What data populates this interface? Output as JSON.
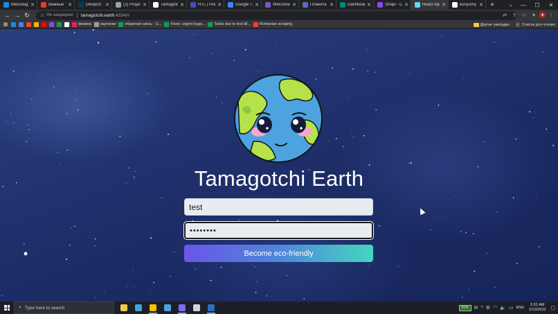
{
  "browser": {
    "tabs": [
      {
        "label": "Мессенд",
        "color": "#1e88e5"
      },
      {
        "label": "Важные те",
        "color": "#e53935"
      },
      {
        "label": "Devpost",
        "color": "#003e54",
        "glyph": "D"
      },
      {
        "label": "(2) Project",
        "color": "#90a4ae"
      },
      {
        "label": "Tamagotc",
        "color": "#ffffff"
      },
      {
        "label": "HTL | Prezi",
        "color": "#3f51b5"
      },
      {
        "label": "Google Tra",
        "color": "#4285f4"
      },
      {
        "label": "Welcome t",
        "color": "#7e57c2"
      },
      {
        "label": "Планета —",
        "color": "#5c6bc0"
      },
      {
        "label": "Dashboard",
        "color": "#00897b"
      },
      {
        "label": "Strapi - Co",
        "color": "#8e44ff"
      },
      {
        "label": "React App",
        "color": "#61dafb",
        "active": true
      },
      {
        "label": "kuriyumy",
        "color": "#ffffff"
      }
    ],
    "new_tab_label": "+",
    "address": {
      "security_label": "Не защищено",
      "host": "tamagotchi.earth",
      "path": ":4334/#"
    },
    "bookmarks": [
      {
        "label": "",
        "color": "#1e88e5"
      },
      {
        "label": "",
        "color": "#4285f4"
      },
      {
        "label": "",
        "color": "#ea4335"
      },
      {
        "label": "",
        "color": "#f4b400"
      },
      {
        "label": "",
        "color": "#ff0000"
      },
      {
        "label": "",
        "color": "#7c4dff"
      },
      {
        "label": "",
        "color": "#0f9d58"
      },
      {
        "label": "",
        "color": "#ffffff"
      },
      {
        "label": "физика",
        "color": "#e91e63"
      },
      {
        "label": "картинки",
        "color": "#9e9e9e"
      },
      {
        "label": "обратная связь - G...",
        "color": "#0f9d58"
      },
      {
        "label": "Fixes: urgent bugs...",
        "color": "#0f9d58"
      },
      {
        "label": "Tasks due to test till...",
        "color": "#0f9d58"
      },
      {
        "label": "Romanian scraping",
        "color": "#ea4335"
      }
    ],
    "other_bookmarks": "Другие закладки",
    "reading_list": "Список для чтения"
  },
  "app": {
    "title": "Tamagotchi Earth",
    "username_value": "test",
    "password_value": "••••••••",
    "submit_label": "Become eco-friendly"
  },
  "taskbar": {
    "search_placeholder": "Type here to search",
    "battery": "51%",
    "language": "ENG",
    "time": "5:51 AM",
    "date": "2/13/2022",
    "apps": [
      {
        "name": "file-explorer",
        "color": "#f2c94c"
      },
      {
        "name": "notepad",
        "color": "#3ba7d9"
      },
      {
        "name": "chrome",
        "color": "#fbbc04",
        "active": true
      },
      {
        "name": "messenger",
        "color": "#4aa3df"
      },
      {
        "name": "discord",
        "color": "#7b6df0",
        "active": true
      },
      {
        "name": "settings",
        "color": "#cfd3da"
      },
      {
        "name": "terminal",
        "color": "#2a6fbf",
        "active": true
      }
    ]
  }
}
